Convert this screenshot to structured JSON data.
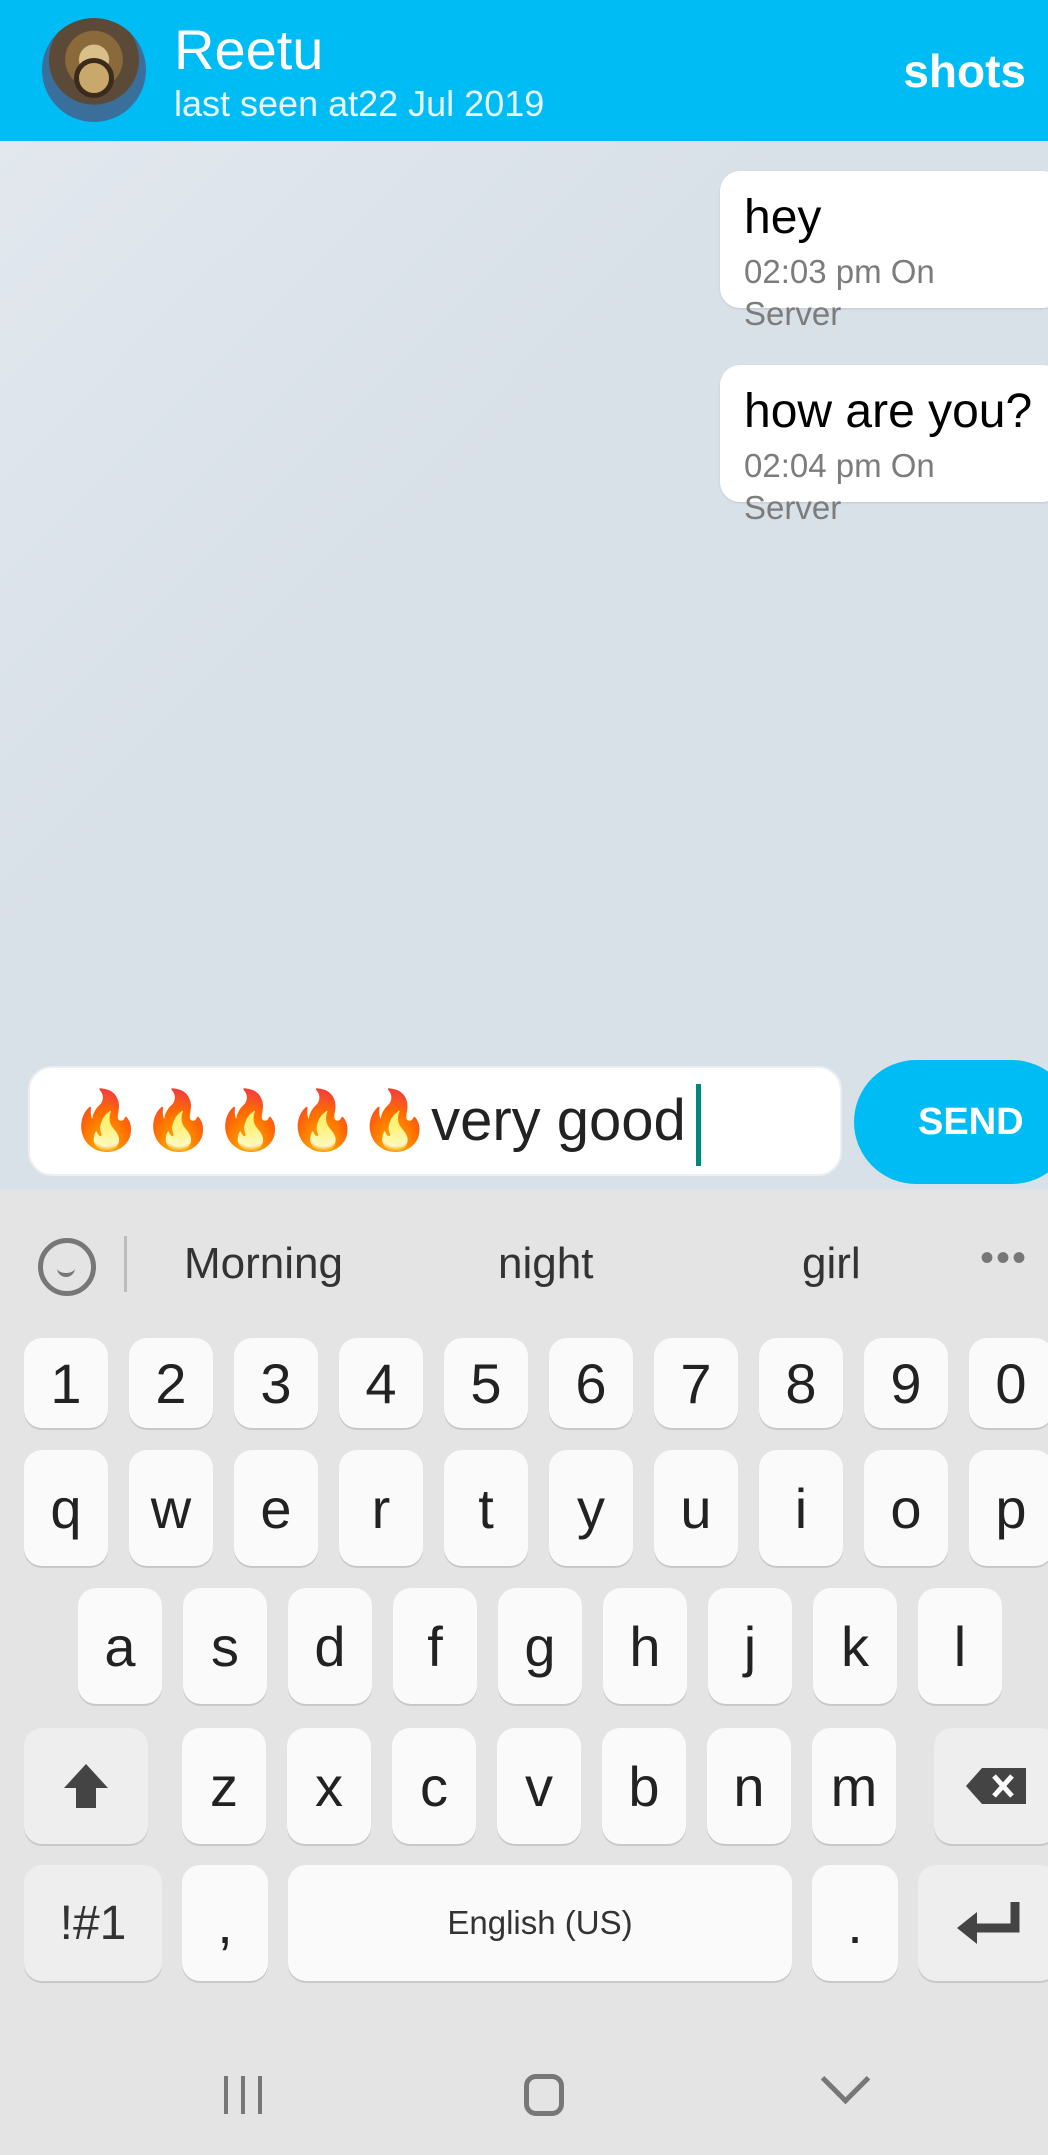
{
  "header": {
    "contact_name": "Reetu",
    "last_seen": "last seen at22 Jul 2019",
    "action_label": "shots"
  },
  "messages": [
    {
      "text": "hey",
      "meta": "02:03 pm On Server"
    },
    {
      "text": "how are you?",
      "meta": "02:04 pm On Server"
    }
  ],
  "composer": {
    "emojis": "🔥🔥🔥🔥🔥",
    "value": "very good",
    "send_label": "SEND"
  },
  "keyboard": {
    "suggestions": [
      "Morning",
      "night",
      "girl"
    ],
    "number_row": [
      "1",
      "2",
      "3",
      "4",
      "5",
      "6",
      "7",
      "8",
      "9",
      "0"
    ],
    "row1": [
      "q",
      "w",
      "e",
      "r",
      "t",
      "y",
      "u",
      "i",
      "o",
      "p"
    ],
    "row2": [
      "a",
      "s",
      "d",
      "f",
      "g",
      "h",
      "j",
      "k",
      "l"
    ],
    "row3": [
      "z",
      "x",
      "c",
      "v",
      "b",
      "n",
      "m"
    ],
    "symbols_label": "!#1",
    "comma_label": ",",
    "space_label": "English (US)",
    "period_label": "."
  },
  "colors": {
    "accent": "#00bcf5",
    "caret": "#00897b"
  },
  "icons": {
    "sync": "sync-icon",
    "more": "more-icon",
    "shift": "shift-icon",
    "backspace": "backspace-icon",
    "enter": "enter-icon"
  }
}
